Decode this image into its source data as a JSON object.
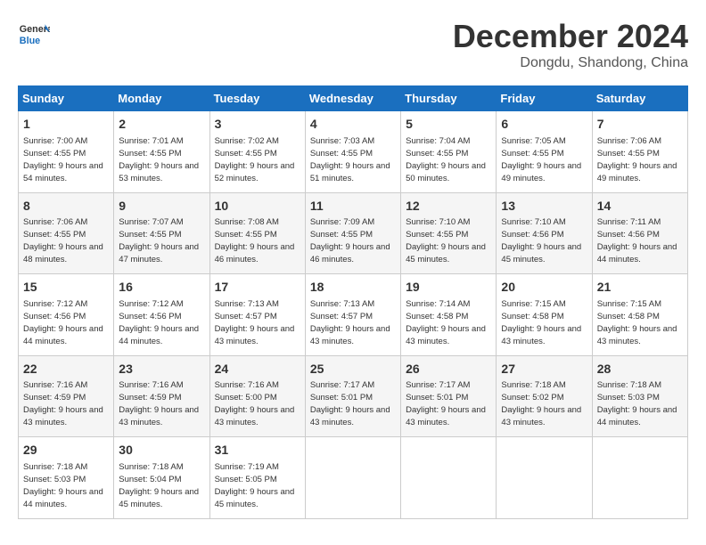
{
  "logo": {
    "text_general": "General",
    "text_blue": "Blue"
  },
  "header": {
    "month": "December 2024",
    "location": "Dongdu, Shandong, China"
  },
  "weekdays": [
    "Sunday",
    "Monday",
    "Tuesday",
    "Wednesday",
    "Thursday",
    "Friday",
    "Saturday"
  ],
  "weeks": [
    [
      {
        "day": 1,
        "sunrise": "7:00 AM",
        "sunset": "4:55 PM",
        "daylight": "9 hours and 54 minutes."
      },
      {
        "day": 2,
        "sunrise": "7:01 AM",
        "sunset": "4:55 PM",
        "daylight": "9 hours and 53 minutes."
      },
      {
        "day": 3,
        "sunrise": "7:02 AM",
        "sunset": "4:55 PM",
        "daylight": "9 hours and 52 minutes."
      },
      {
        "day": 4,
        "sunrise": "7:03 AM",
        "sunset": "4:55 PM",
        "daylight": "9 hours and 51 minutes."
      },
      {
        "day": 5,
        "sunrise": "7:04 AM",
        "sunset": "4:55 PM",
        "daylight": "9 hours and 50 minutes."
      },
      {
        "day": 6,
        "sunrise": "7:05 AM",
        "sunset": "4:55 PM",
        "daylight": "9 hours and 49 minutes."
      },
      {
        "day": 7,
        "sunrise": "7:06 AM",
        "sunset": "4:55 PM",
        "daylight": "9 hours and 49 minutes."
      }
    ],
    [
      {
        "day": 8,
        "sunrise": "7:06 AM",
        "sunset": "4:55 PM",
        "daylight": "9 hours and 48 minutes."
      },
      {
        "day": 9,
        "sunrise": "7:07 AM",
        "sunset": "4:55 PM",
        "daylight": "9 hours and 47 minutes."
      },
      {
        "day": 10,
        "sunrise": "7:08 AM",
        "sunset": "4:55 PM",
        "daylight": "9 hours and 46 minutes."
      },
      {
        "day": 11,
        "sunrise": "7:09 AM",
        "sunset": "4:55 PM",
        "daylight": "9 hours and 46 minutes."
      },
      {
        "day": 12,
        "sunrise": "7:10 AM",
        "sunset": "4:55 PM",
        "daylight": "9 hours and 45 minutes."
      },
      {
        "day": 13,
        "sunrise": "7:10 AM",
        "sunset": "4:56 PM",
        "daylight": "9 hours and 45 minutes."
      },
      {
        "day": 14,
        "sunrise": "7:11 AM",
        "sunset": "4:56 PM",
        "daylight": "9 hours and 44 minutes."
      }
    ],
    [
      {
        "day": 15,
        "sunrise": "7:12 AM",
        "sunset": "4:56 PM",
        "daylight": "9 hours and 44 minutes."
      },
      {
        "day": 16,
        "sunrise": "7:12 AM",
        "sunset": "4:56 PM",
        "daylight": "9 hours and 44 minutes."
      },
      {
        "day": 17,
        "sunrise": "7:13 AM",
        "sunset": "4:57 PM",
        "daylight": "9 hours and 43 minutes."
      },
      {
        "day": 18,
        "sunrise": "7:13 AM",
        "sunset": "4:57 PM",
        "daylight": "9 hours and 43 minutes."
      },
      {
        "day": 19,
        "sunrise": "7:14 AM",
        "sunset": "4:58 PM",
        "daylight": "9 hours and 43 minutes."
      },
      {
        "day": 20,
        "sunrise": "7:15 AM",
        "sunset": "4:58 PM",
        "daylight": "9 hours and 43 minutes."
      },
      {
        "day": 21,
        "sunrise": "7:15 AM",
        "sunset": "4:58 PM",
        "daylight": "9 hours and 43 minutes."
      }
    ],
    [
      {
        "day": 22,
        "sunrise": "7:16 AM",
        "sunset": "4:59 PM",
        "daylight": "9 hours and 43 minutes."
      },
      {
        "day": 23,
        "sunrise": "7:16 AM",
        "sunset": "4:59 PM",
        "daylight": "9 hours and 43 minutes."
      },
      {
        "day": 24,
        "sunrise": "7:16 AM",
        "sunset": "5:00 PM",
        "daylight": "9 hours and 43 minutes."
      },
      {
        "day": 25,
        "sunrise": "7:17 AM",
        "sunset": "5:01 PM",
        "daylight": "9 hours and 43 minutes."
      },
      {
        "day": 26,
        "sunrise": "7:17 AM",
        "sunset": "5:01 PM",
        "daylight": "9 hours and 43 minutes."
      },
      {
        "day": 27,
        "sunrise": "7:18 AM",
        "sunset": "5:02 PM",
        "daylight": "9 hours and 43 minutes."
      },
      {
        "day": 28,
        "sunrise": "7:18 AM",
        "sunset": "5:03 PM",
        "daylight": "9 hours and 44 minutes."
      }
    ],
    [
      {
        "day": 29,
        "sunrise": "7:18 AM",
        "sunset": "5:03 PM",
        "daylight": "9 hours and 44 minutes."
      },
      {
        "day": 30,
        "sunrise": "7:18 AM",
        "sunset": "5:04 PM",
        "daylight": "9 hours and 45 minutes."
      },
      {
        "day": 31,
        "sunrise": "7:19 AM",
        "sunset": "5:05 PM",
        "daylight": "9 hours and 45 minutes."
      },
      null,
      null,
      null,
      null
    ]
  ]
}
